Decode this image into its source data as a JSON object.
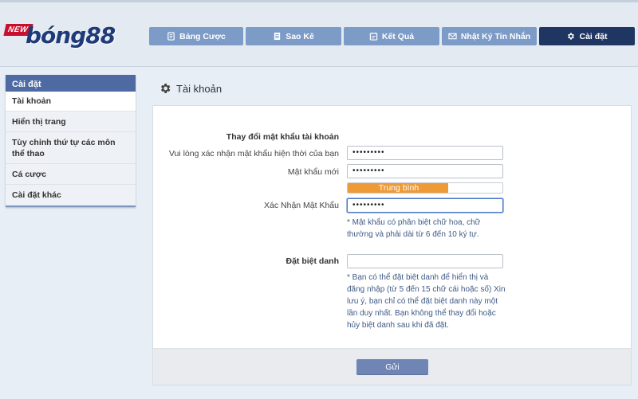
{
  "logo": {
    "badge": "NEW",
    "text": "bóng88"
  },
  "nav": [
    {
      "label": "Bảng Cược",
      "icon": "betslip-icon",
      "active": false
    },
    {
      "label": "Sao Kê",
      "icon": "statement-icon",
      "active": false
    },
    {
      "label": "Kết Quả",
      "icon": "results-icon",
      "active": false
    },
    {
      "label": "Nhật Ký Tin Nhắn",
      "icon": "mail-icon",
      "active": false
    },
    {
      "label": "Cài đặt",
      "icon": "gear-icon",
      "active": true
    }
  ],
  "sidebar": {
    "title": "Cài đặt",
    "items": [
      {
        "label": "Tài khoản",
        "active": true
      },
      {
        "label": "Hiển thị trang",
        "active": false
      },
      {
        "label": "Tùy chỉnh thứ tự các môn thể thao",
        "active": false
      },
      {
        "label": "Cá cược",
        "active": false
      },
      {
        "label": "Cài đặt khác",
        "active": false
      }
    ]
  },
  "page": {
    "title": "Tài khoản",
    "icon": "gear-icon"
  },
  "form": {
    "password_section_title": "Thay đổi mật khẩu tài khoản",
    "current_password_label": "Vui lòng xác nhận mật khẩu hiện thời của bạn",
    "current_password_value": "•••••••••",
    "new_password_label": "Mật khẩu mới",
    "new_password_value": "•••••••••",
    "strength_label": "Trung bình",
    "strength_fraction": 0.65,
    "confirm_password_label": "Xác Nhận Mật Khẩu",
    "confirm_password_value": "•••••••••",
    "password_note": "* Mật khẩu có phân biệt chữ hoa, chữ thường và phải dài từ 6 đến 10 ký tự.",
    "nickname_label": "Đặt biệt danh",
    "nickname_value": "",
    "nickname_note": "* Bạn có thể đặt biệt danh để hiển thị và đăng nhập (từ 5 đến 15 chữ cái hoặc số) Xin lưu ý, bạn chỉ có thể đặt biệt danh này một lần duy nhất. Bạn không thể thay đổi hoặc hủy biệt danh sau khi đã đặt.",
    "submit_label": "Gửi"
  },
  "colors": {
    "nav_button": "#7d9bc7",
    "nav_active": "#1f3562",
    "sidebar_header": "#4e6aa3",
    "strength_fill": "#ee9a37",
    "submit_button": "#6f85b5",
    "note_text": "#3f5a86"
  }
}
